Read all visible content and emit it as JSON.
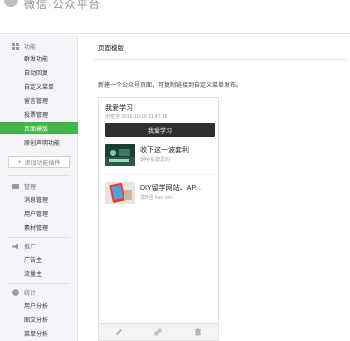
{
  "app": {
    "title": "微信·公众平台"
  },
  "sidebar": {
    "sections": [
      {
        "heading": "功能",
        "icon": "grid-icon",
        "items": [
          "群发功能",
          "自动回复",
          "自定义菜单",
          "留言管理",
          "投票管理",
          "页面模版",
          "原创声明功能"
        ]
      },
      {
        "heading": "管理",
        "icon": "message-icon",
        "items": [
          "消息管理",
          "用户管理",
          "素材管理"
        ]
      },
      {
        "heading": "推广",
        "icon": "megaphone-icon",
        "items": [
          "广告主",
          "流量主"
        ]
      },
      {
        "heading": "统计",
        "icon": "chart-icon",
        "items": [
          "用户分析",
          "图文分析",
          "菜单分析"
        ]
      }
    ],
    "active_item": "页面模版",
    "add_button_label": "添加功能插件"
  },
  "main": {
    "page_title": "页面模版",
    "description": "新建一个公众号页面，可复制链接到自定义菜单发布。",
    "preview": {
      "title": "我爱学习",
      "meta": "浏览字 2016-10-15 11:47:16",
      "button_label": "我爱学习",
      "articles": [
        {
          "title": "收下这一波套利",
          "subtitle": "朝哈军旗爱的"
        },
        {
          "title": "DIY留学网站、AP...",
          "subtitle": "澳B强 hao nen"
        }
      ],
      "toolbar": [
        "edit-icon",
        "link-icon",
        "trash-icon"
      ]
    }
  },
  "colors": {
    "accent": "#44b549",
    "dark_button": "#2f2f2f",
    "sidebar_bg": "#f4f5f9"
  }
}
